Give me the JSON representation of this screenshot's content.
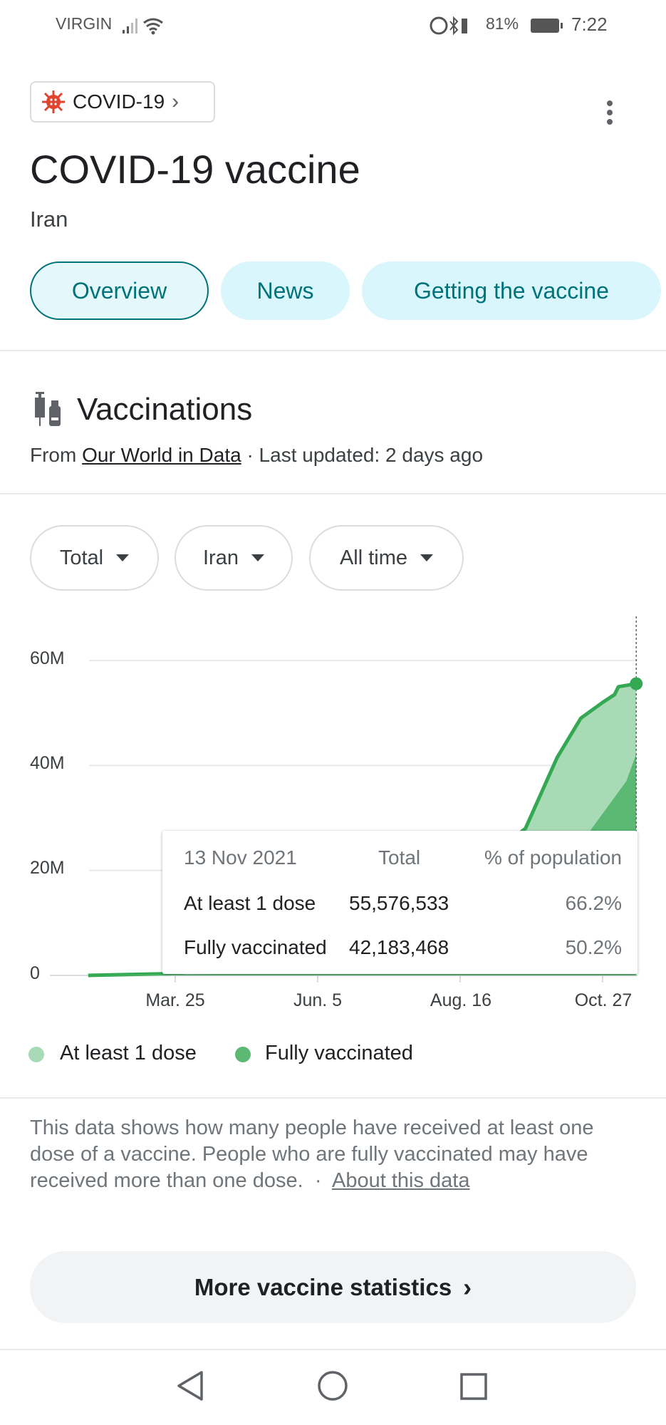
{
  "status_bar": {
    "carrier": "VIRGIN",
    "battery": "81%",
    "time": "7:22"
  },
  "header": {
    "chip_label": "COVID-19",
    "title": "COVID-19 vaccine",
    "subtitle": "Iran"
  },
  "tabs": [
    {
      "label": "Overview",
      "active": true
    },
    {
      "label": "News"
    },
    {
      "label": "Getting the vaccine"
    }
  ],
  "section": {
    "title": "Vaccinations",
    "source_prefix": "From",
    "source_link": "Our World in Data",
    "updated": "· Last updated: 2 days ago"
  },
  "filters": [
    {
      "label": "Total"
    },
    {
      "label": "Iran"
    },
    {
      "label": "All time"
    }
  ],
  "tooltip": {
    "date": "13 Nov 2021",
    "col_total": "Total",
    "col_pct": "% of population",
    "rows": [
      {
        "label": "At least 1 dose",
        "total": "55,576,533",
        "pct": "66.2%"
      },
      {
        "label": "Fully vaccinated",
        "total": "42,183,468",
        "pct": "50.2%"
      }
    ]
  },
  "chart_data": {
    "type": "area",
    "ylim": [
      0,
      60000000
    ],
    "yticks": [
      "0",
      "20M",
      "40M",
      "60M"
    ],
    "xticks": [
      "Mar. 25",
      "Jun. 5",
      "Aug. 16",
      "Oct. 27"
    ],
    "xtick_dates": [
      "2021-03-25",
      "2021-06-05",
      "2021-08-16",
      "2021-10-27"
    ],
    "grid": true,
    "legend_placement": "bottom",
    "series": [
      {
        "name": "At least 1 dose",
        "color": "#a8dab5",
        "line_color": "#34a853",
        "points": [
          [
            "2021-02-09",
            0
          ],
          [
            "2021-03-25",
            350000
          ],
          [
            "2021-06-05",
            4000000
          ],
          [
            "2021-07-15",
            10000000
          ],
          [
            "2021-08-16",
            18000000
          ],
          [
            "2021-09-18",
            28000000
          ],
          [
            "2021-10-04",
            41500000
          ],
          [
            "2021-10-16",
            49000000
          ],
          [
            "2021-10-27",
            52000000
          ],
          [
            "2021-11-02",
            53500000
          ],
          [
            "2021-11-04",
            55000000
          ],
          [
            "2021-11-13",
            55576533
          ]
        ]
      },
      {
        "name": "Fully vaccinated",
        "color": "#5bb974",
        "points": [
          [
            "2021-02-09",
            0
          ],
          [
            "2021-06-05",
            500000
          ],
          [
            "2021-08-16",
            5000000
          ],
          [
            "2021-09-18",
            12000000
          ],
          [
            "2021-10-10",
            20000000
          ],
          [
            "2021-10-21",
            27700000
          ],
          [
            "2021-11-08",
            37000000
          ],
          [
            "2021-11-13",
            42183468
          ]
        ]
      }
    ]
  },
  "description": {
    "text": "This data shows how many people have received at least one dose of a vaccine. People who are fully vaccinated may have received more than one dose.",
    "separator": "·",
    "link": "About this data"
  },
  "more_button": {
    "label": "More vaccine statistics"
  }
}
